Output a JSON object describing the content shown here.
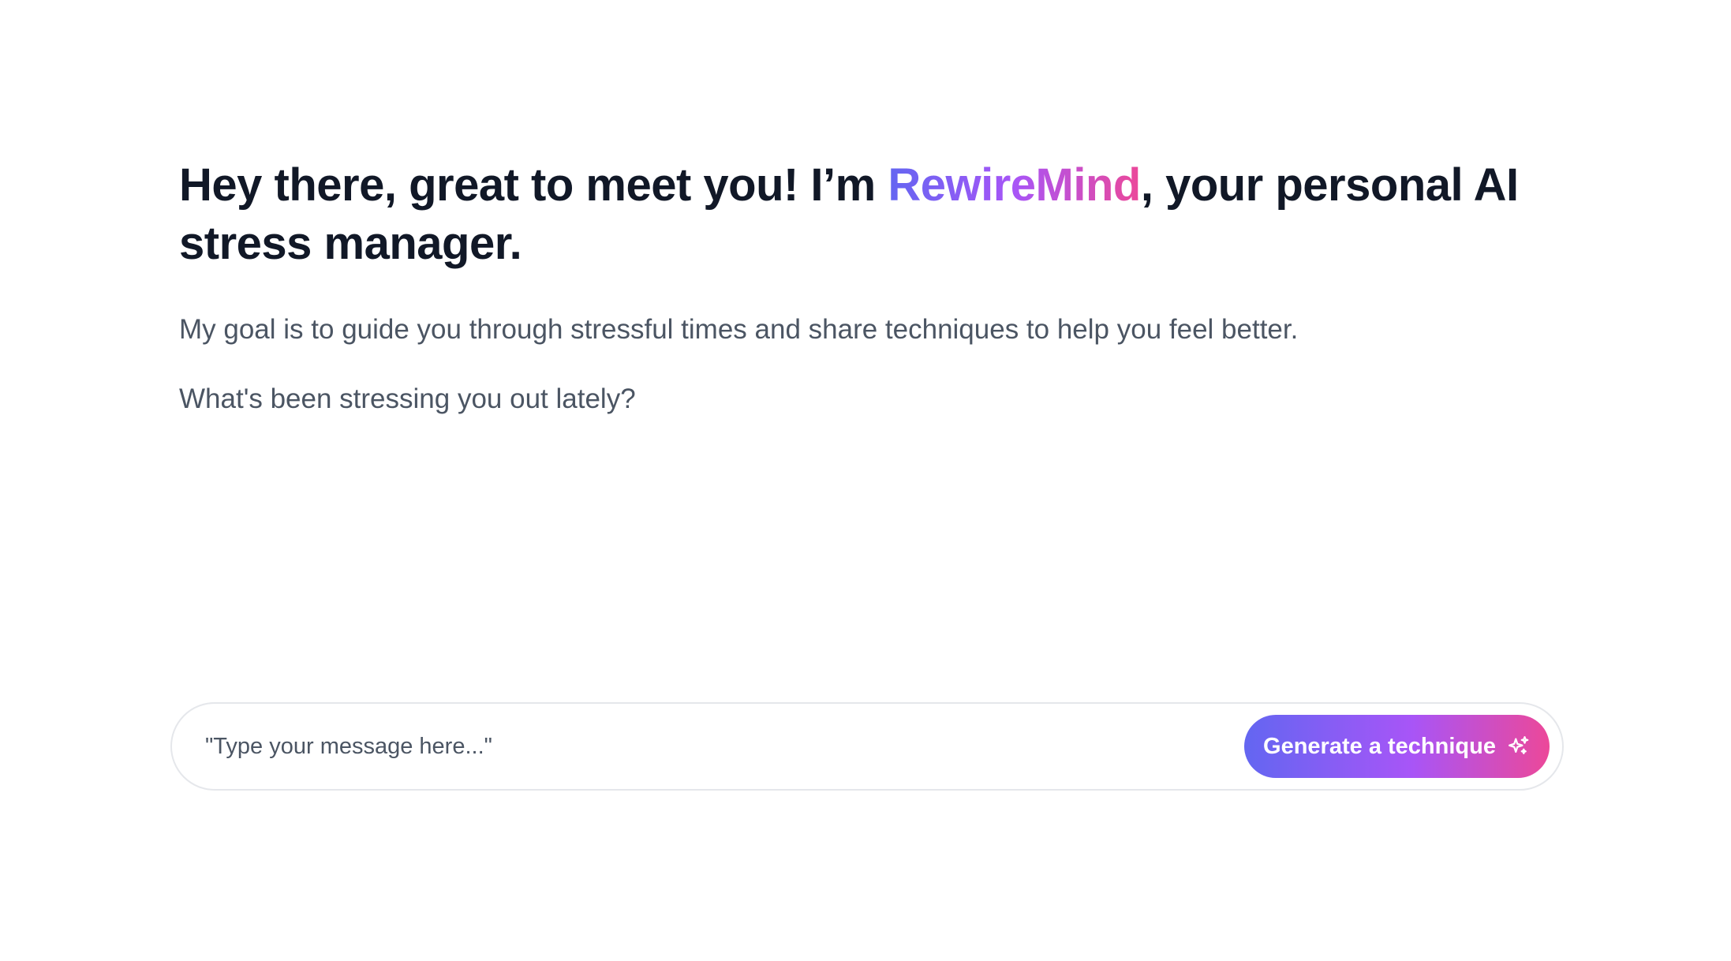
{
  "hero": {
    "headline_before": "Hey there, great to meet you! I’m ",
    "brand_name": "RewireMind",
    "headline_after": ", your personal AI stress manager.",
    "goal_text": "My goal is to guide you through stressful times and share techniques to help you feel better.",
    "question_text": "What's been stressing you out lately?"
  },
  "composer": {
    "placeholder": "\"Type your message here...\"",
    "button_label": "Generate a technique",
    "button_icon": "sparkles-icon"
  },
  "colors": {
    "gradient_start": "#6366f1",
    "gradient_mid": "#a855f7",
    "gradient_end": "#ec4899",
    "heading": "#111827",
    "body_text": "#4b5563"
  }
}
